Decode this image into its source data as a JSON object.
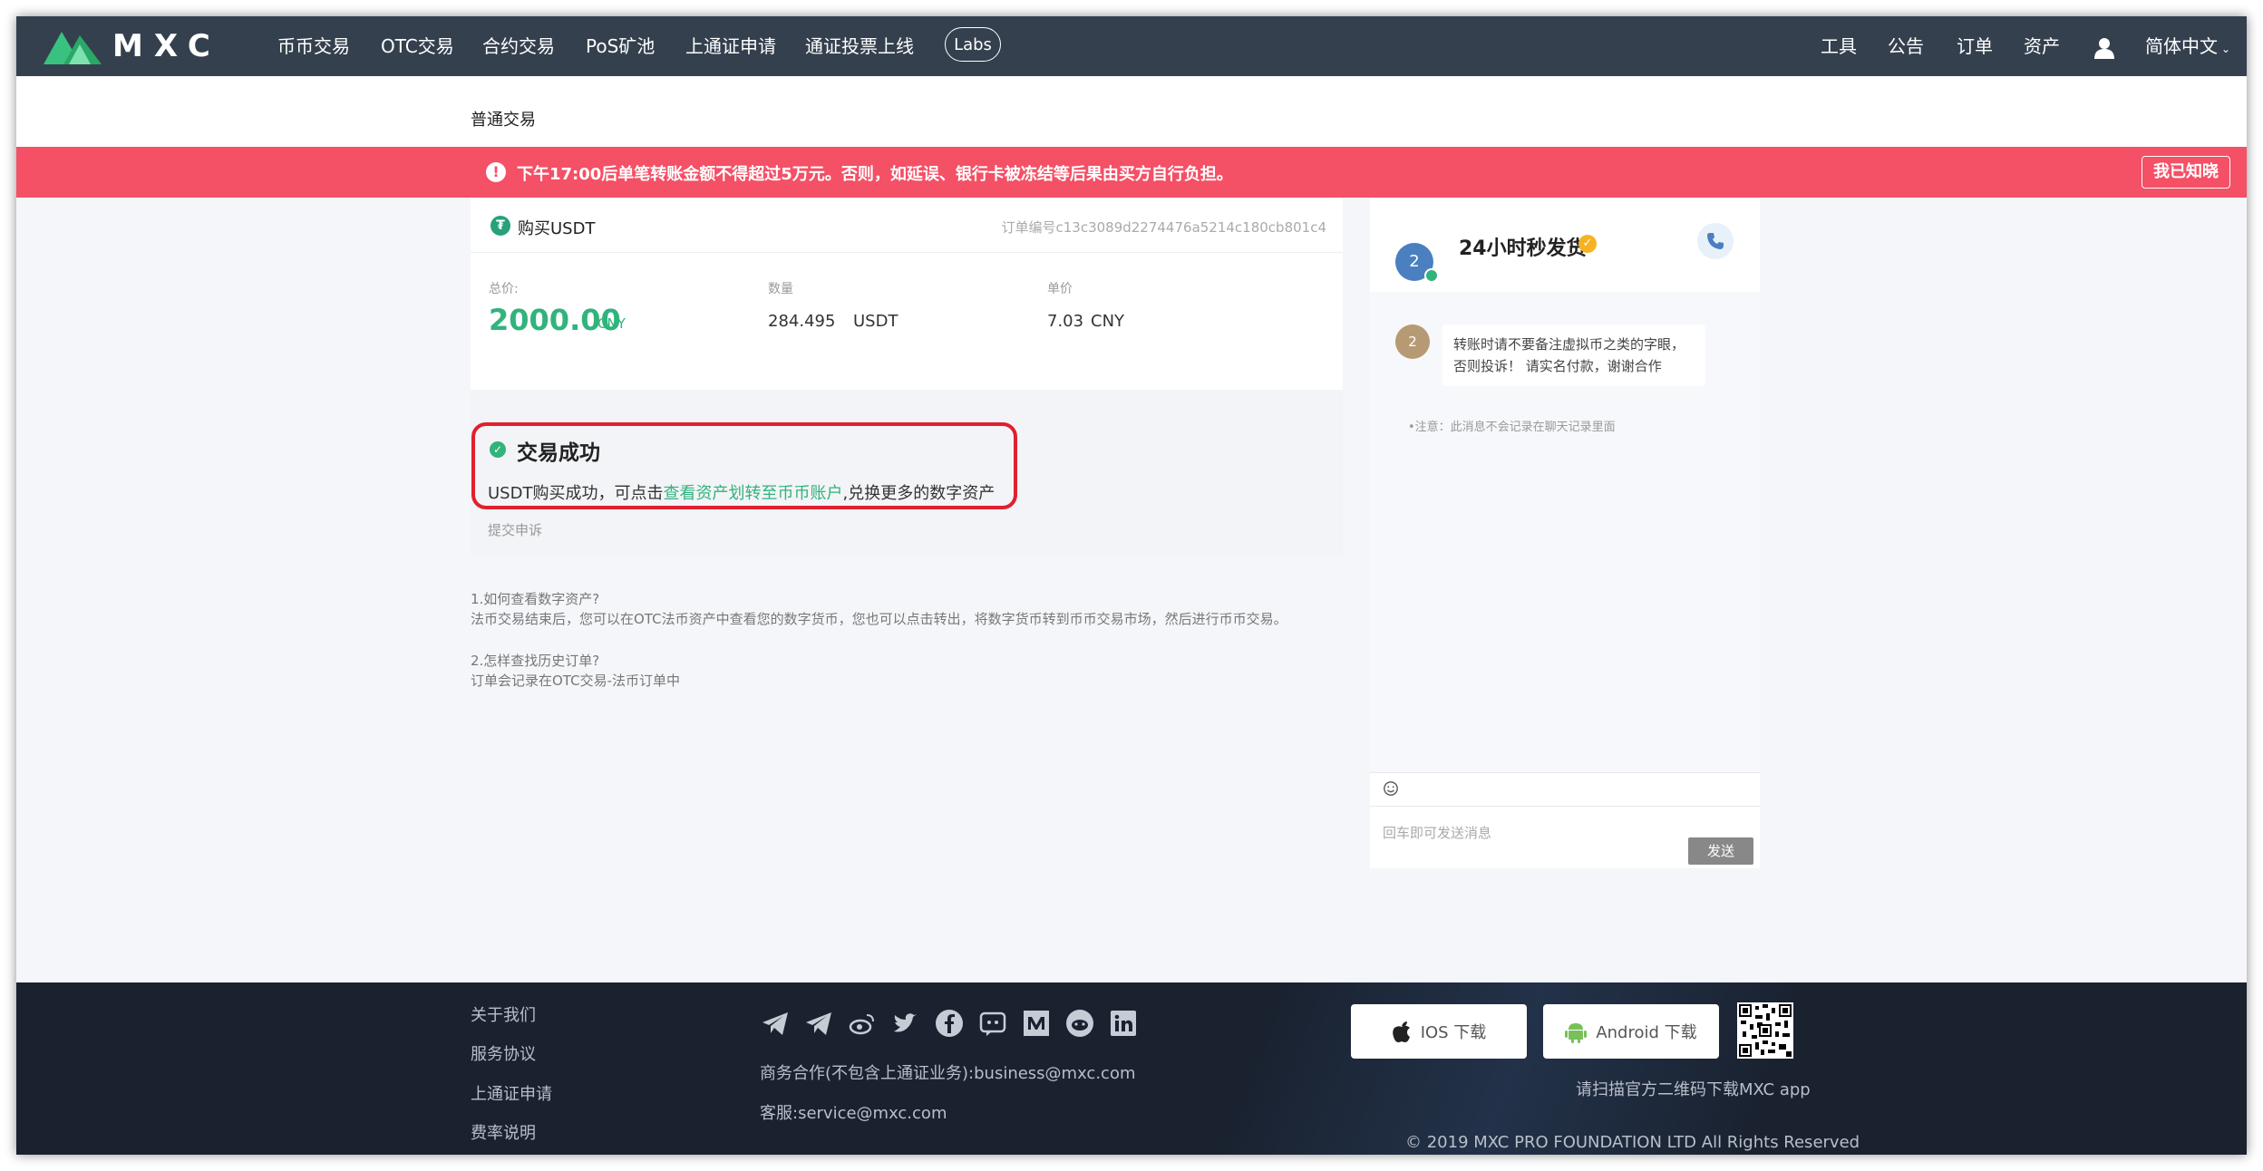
{
  "nav": {
    "logo": "MXC",
    "items": [
      "币币交易",
      "OTC交易",
      "合约交易",
      "PoS矿池",
      "上通证申请",
      "通证投票上线"
    ],
    "labs": "Labs",
    "right": [
      "工具",
      "公告",
      "订单",
      "资产"
    ],
    "language": "简体中文"
  },
  "subheader": {
    "title": "普通交易"
  },
  "alert": {
    "text": "下午17:00后单笔转账金额不得超过5万元。否则，如延误、银行卡被冻结等后果由买方自行负担。",
    "button": "我已知晓"
  },
  "order": {
    "title": "购买USDT",
    "order_id": "订单编号c13c3089d2274476a5214c180cb801c4",
    "total_label": "总价:",
    "total_value": "2000.00",
    "total_currency": "CNY",
    "qty_label": "数量",
    "qty_value": "284.495",
    "qty_unit": "USDT",
    "price_label": "单价",
    "price_value": "7.03",
    "price_unit": "CNY"
  },
  "success": {
    "title": "交易成功",
    "desc_pre": "USDT购买成功，可点击",
    "desc_link": "查看资产划转至币币账户",
    "desc_post": ",兑换更多的数字资产",
    "appeal": "提交申诉"
  },
  "faq": [
    {
      "q": "1.如何查看数字资产?",
      "a": "法币交易结束后，您可以在OTC法币资产中查看您的数字货币，您也可以点击转出，将数字货币转到币币交易市场，然后进行币币交易。"
    },
    {
      "q": "2.怎样查找历史订单?",
      "a": "订单会记录在OTC交易-法币订单中"
    }
  ],
  "chat": {
    "avatar": "2",
    "name": "24小时秒发货",
    "message": "转账时请不要备注虚拟币之类的字眼，否则投诉！ 请实名付款，谢谢合作",
    "notice": "•注意：此消息不会记录在聊天记录里面",
    "input_placeholder": "回车即可发送消息",
    "send": "发送"
  },
  "footer": {
    "links": [
      "关于我们",
      "服务协议",
      "上通证申请",
      "费率说明"
    ],
    "business": "商务合作(不包含上通证业务):business@mxc.com",
    "service": "客服:service@mxc.com",
    "ios": "IOS 下载",
    "android": "Android 下载",
    "qr_text": "请扫描官方二维码下载MXC app",
    "copyright": "© 2019 MXC PRO FOUNDATION LTD All Rights Reserved"
  },
  "colors": {
    "nav_bg": "#34404e",
    "alert_bg": "#f45066",
    "accent_green": "#31b37c",
    "highlight_red": "#e0202e",
    "footer_bg": "#1a2230"
  }
}
